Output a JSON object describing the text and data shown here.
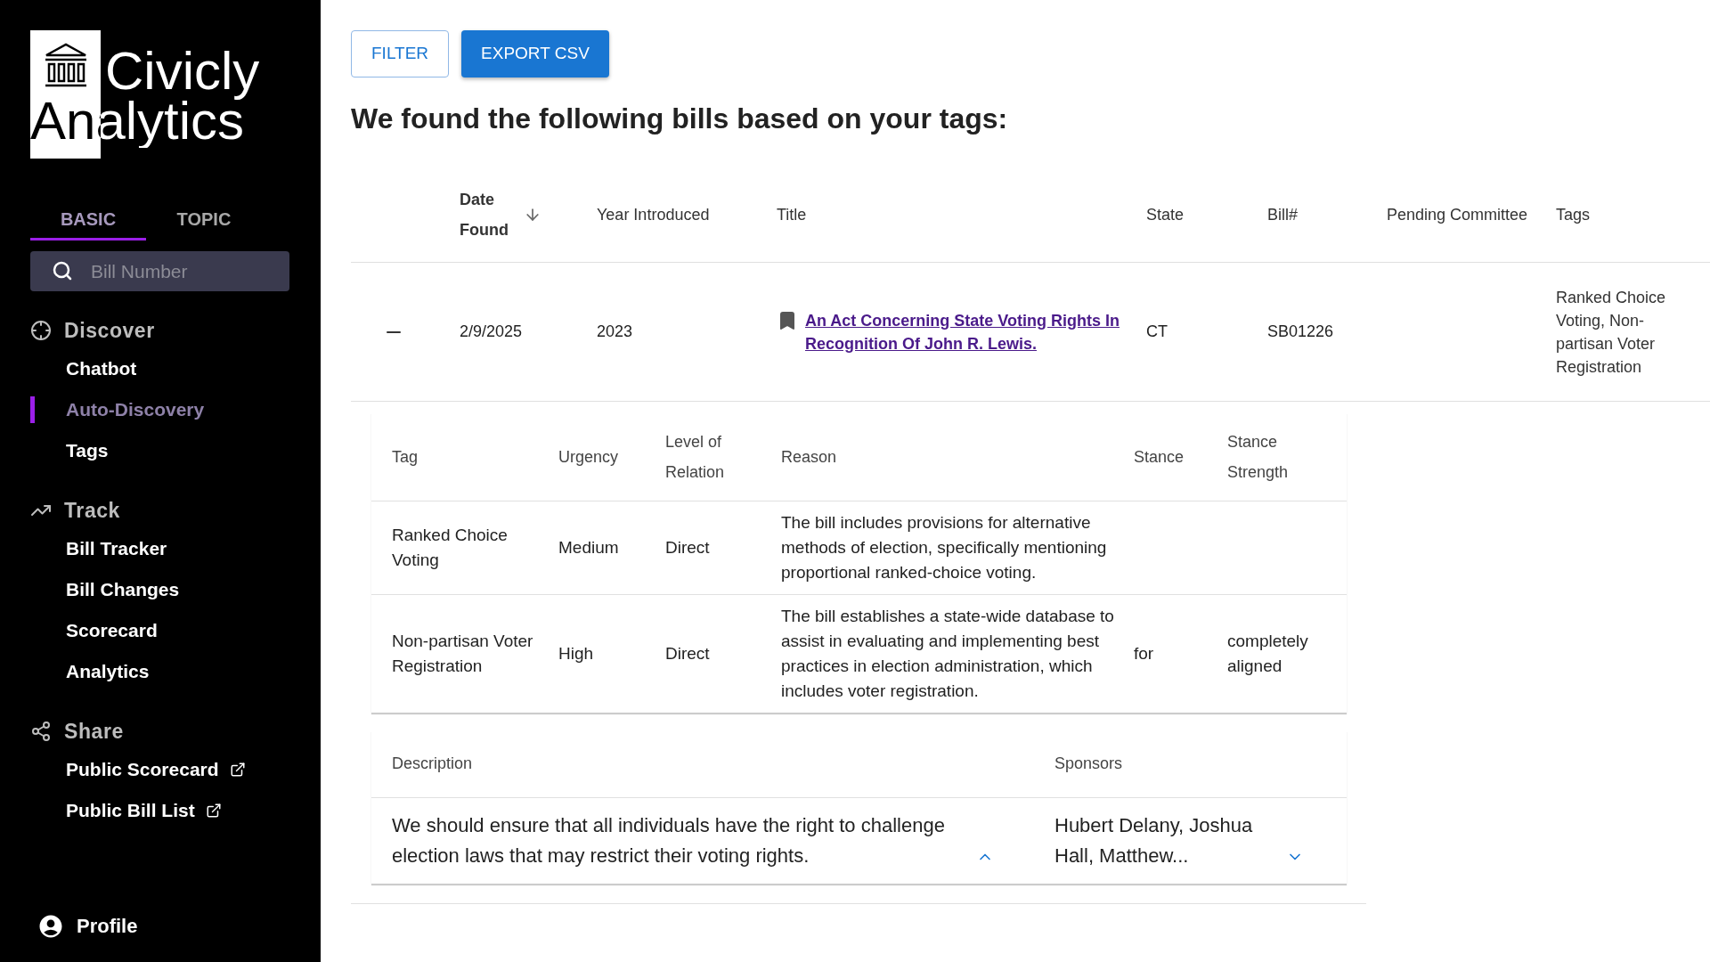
{
  "sidebar": {
    "logo_lines": [
      "Civicly",
      "Analytics"
    ],
    "tabs": [
      {
        "label": "BASIC",
        "selected": true
      },
      {
        "label": "TOPIC",
        "selected": false
      }
    ],
    "search": {
      "placeholder": "Bill Number"
    },
    "sections": [
      {
        "title": "Discover",
        "kind": "discover",
        "items": [
          {
            "label": "Chatbot",
            "selected": false,
            "external": false
          },
          {
            "label": "Auto-Discovery",
            "selected": true,
            "external": false
          },
          {
            "label": "Tags",
            "selected": false,
            "external": false
          }
        ]
      },
      {
        "title": "Track",
        "kind": "track",
        "items": [
          {
            "label": "Bill Tracker",
            "selected": false,
            "external": false
          },
          {
            "label": "Bill Changes",
            "selected": false,
            "external": false
          },
          {
            "label": "Scorecard",
            "selected": false,
            "external": false
          },
          {
            "label": "Analytics",
            "selected": false,
            "external": false
          }
        ]
      },
      {
        "title": "Share",
        "kind": "share",
        "items": [
          {
            "label": "Public Scorecard",
            "selected": false,
            "external": true
          },
          {
            "label": "Public Bill List",
            "selected": false,
            "external": true
          }
        ]
      }
    ],
    "profile": "Profile"
  },
  "toolbar": [
    {
      "label": "FILTER",
      "kind": "outlined"
    },
    {
      "label": "EXPORT CSV",
      "kind": "contained"
    }
  ],
  "heading": "We found the following bills based on your tags:",
  "table": {
    "columns": [
      {
        "label": "Date Found",
        "sorted": true
      },
      {
        "label": "Year Introduced",
        "sorted": false
      },
      {
        "label": "Title",
        "sorted": false
      },
      {
        "label": "State",
        "sorted": false
      },
      {
        "label": "Bill#",
        "sorted": false
      },
      {
        "label": "Pending Committee",
        "sorted": false
      },
      {
        "label": "Tags",
        "sorted": false
      }
    ],
    "rows": [
      {
        "expanded": true,
        "date_found": "2/9/2025",
        "year": "2023",
        "bookmarked": true,
        "title": "An Act Concerning State Voting Rights In Recognition Of John R. Lewis.",
        "state": "CT",
        "bill": "SB01226",
        "tags": "Ranked Choice Voting, Non-partisan Voter Registration",
        "details": {
          "columns": [
            "Tag",
            "Urgency",
            "Level of Relation",
            "Reason",
            "Stance",
            "Stance Strength"
          ],
          "rows": [
            [
              "Ranked Choice Voting",
              "Medium",
              "Direct",
              "The bill includes provisions for alternative methods of election, specifically mentioning proportional ranked-choice voting.",
              "",
              ""
            ],
            [
              "Non-partisan Voter Registration",
              "High",
              "Direct",
              "The bill establishes a state-wide database to assist in evaluating and implementing best practices in election administration, which includes voter registration.",
              "for",
              "completely aligned"
            ]
          ],
          "description_header": "Description",
          "sponsors_header": "Sponsors",
          "description": "We should ensure that all individuals have the right to challenge election laws that may restrict their voting rights.",
          "description_expanded": true,
          "sponsors": "Hubert Delany, Joshua Hall, Matthew...",
          "sponsors_expanded": false
        }
      }
    ]
  }
}
